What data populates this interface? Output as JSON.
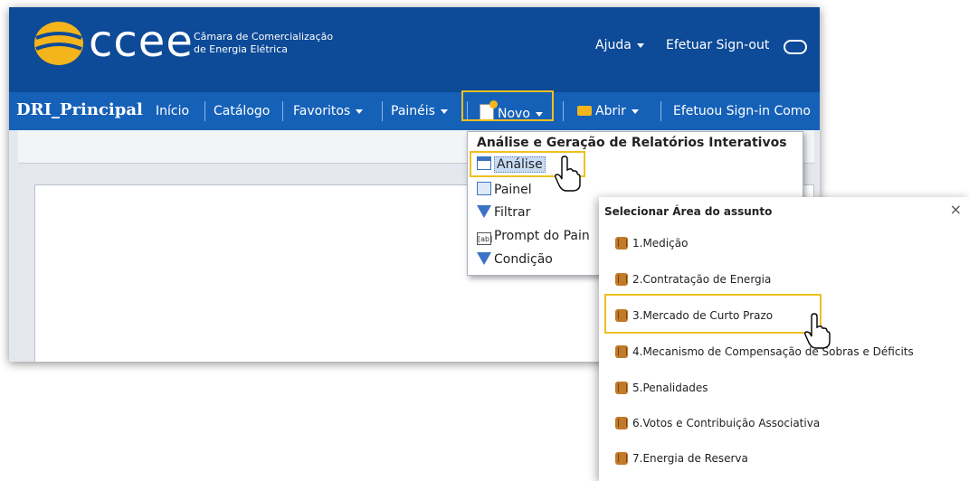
{
  "header": {
    "brand": "ccee",
    "tagline_line1": "Câmara de Comercialização",
    "tagline_line2": "de Energia Elétrica",
    "help_label": "Ajuda",
    "signout_label": "Efetuar Sign-out"
  },
  "nav": {
    "app_title": "DRI_Principal",
    "items": [
      "Início",
      "Catálogo",
      "Favoritos",
      "Painéis",
      "Novo",
      "Abrir",
      "Efetuou Sign-in Como"
    ]
  },
  "menu": {
    "heading": "Análise e Geração de Relatórios Interativos",
    "items": [
      "Análise",
      "Painel",
      "Filtrar",
      "Prompt do Pain",
      "Condição"
    ]
  },
  "subject_area": {
    "title": "Selecionar Área do assunto",
    "close": "×",
    "items": [
      "1.Medição",
      "2.Contratação de Energia",
      "3.Mercado de Curto Prazo",
      "4.Mecanismo de Compensação de Sobras e Déficits",
      "5.Penalidades",
      "6.Votos e Contribuição Associativa",
      "7.Energia de Reserva"
    ]
  },
  "colors": {
    "header_bg": "#0d4a98",
    "nav_bg": "#1661b8",
    "highlight": "#f0c020",
    "logo": "#f3b51b"
  }
}
